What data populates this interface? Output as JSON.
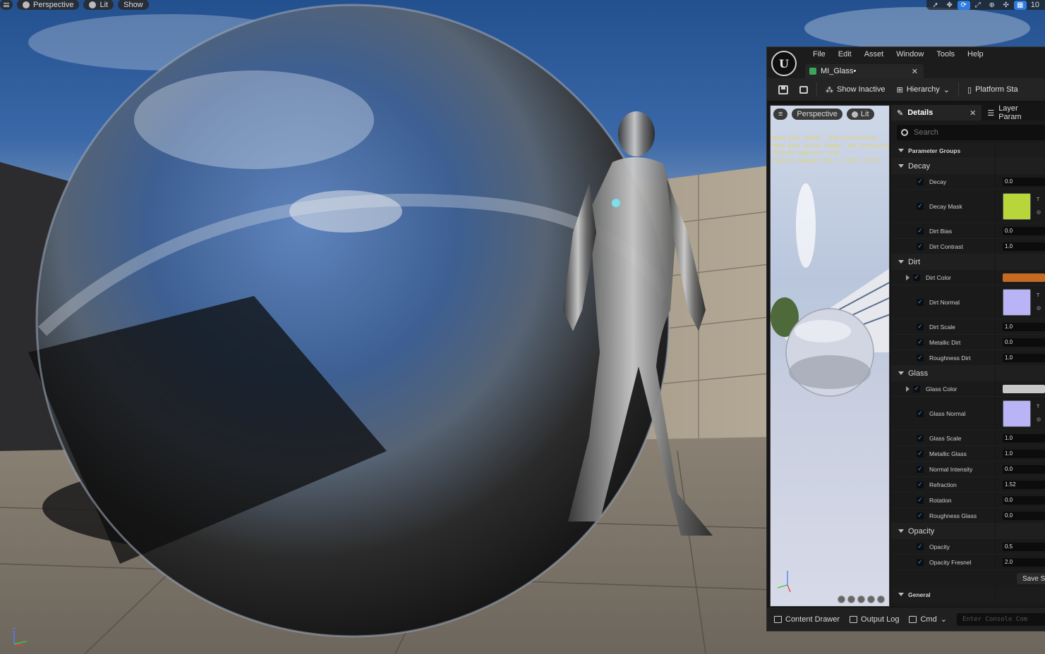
{
  "viewport": {
    "menu_icon": "hamburger-icon",
    "perspective_label": "Perspective",
    "lit_label": "Lit",
    "show_label": "Show",
    "grid_snap_value": "10",
    "tools": [
      "select-arrow-icon",
      "move-icon",
      "rotate-icon",
      "scale-icon",
      "world-globe-icon",
      "surface-snap-icon",
      "grid-icon"
    ]
  },
  "editor": {
    "logo": "U",
    "menu": [
      "File",
      "Edit",
      "Asset",
      "Window",
      "Tools",
      "Help"
    ],
    "doc_tab": "MI_Glass•",
    "toolbar": {
      "show_inactive": "Show Inactive",
      "hierarchy": "Hierarchy",
      "platform_stats": "Platform Sta"
    },
    "preview": {
      "perspective": "Perspective",
      "lit": "Lit",
      "stats": [
        "Base pass shader: 1246 instructions",
        "Base pass vertex shader: 320 instructions",
        "Texture samplers: 9/16",
        "Texture Lookups (Est.): VS(0), PS(3)"
      ]
    },
    "details": {
      "tab_label": "Details",
      "layer_tab": "Layer Param",
      "search_placeholder": "Search",
      "groups_header": "Parameter Groups",
      "groups": [
        {
          "name": "Decay",
          "params": [
            {
              "name": "Decay",
              "kind": "num",
              "value": "0.0"
            },
            {
              "name": "Decay Mask",
              "kind": "tex",
              "color": "#b8d63a"
            },
            {
              "name": "Dirt Bias",
              "kind": "num",
              "value": "0.0"
            },
            {
              "name": "Dirt Contrast",
              "kind": "num",
              "value": "1.0"
            }
          ]
        },
        {
          "name": "Dirt",
          "params": [
            {
              "name": "Dirt Color",
              "kind": "color",
              "color": "#c56a22",
              "expand": true
            },
            {
              "name": "Dirt Normal",
              "kind": "tex",
              "color": "#b9b4f5"
            },
            {
              "name": "Dirt Scale",
              "kind": "num",
              "value": "1.0"
            },
            {
              "name": "Metallic Dirt",
              "kind": "num",
              "value": "0.0"
            },
            {
              "name": "Roughness Dirt",
              "kind": "num",
              "value": "1.0"
            }
          ]
        },
        {
          "name": "Glass",
          "params": [
            {
              "name": "Glass Color",
              "kind": "color",
              "color": "#c8c8c8",
              "expand": true
            },
            {
              "name": "Glass Normal",
              "kind": "tex",
              "color": "#b9b4f5"
            },
            {
              "name": "Glass Scale",
              "kind": "num",
              "value": "1.0"
            },
            {
              "name": "Metallic Glass",
              "kind": "num",
              "value": "1.0"
            },
            {
              "name": "Normal Intensity",
              "kind": "num",
              "value": "0.0"
            },
            {
              "name": "Refraction",
              "kind": "num",
              "value": "1.52"
            },
            {
              "name": "Rotation",
              "kind": "num",
              "value": "0.0"
            },
            {
              "name": "Roughness Glass",
              "kind": "num",
              "value": "0.0"
            }
          ]
        },
        {
          "name": "Opacity",
          "params": [
            {
              "name": "Opacity",
              "kind": "num",
              "value": "0.5"
            },
            {
              "name": "Opacity Fresnel",
              "kind": "num",
              "value": "2.0"
            }
          ]
        }
      ],
      "save_label": "Save S",
      "general_header": "General"
    },
    "status": {
      "content_drawer": "Content Drawer",
      "output_log": "Output Log",
      "cmd": "Cmd",
      "console_placeholder": "Enter Console Com"
    }
  }
}
